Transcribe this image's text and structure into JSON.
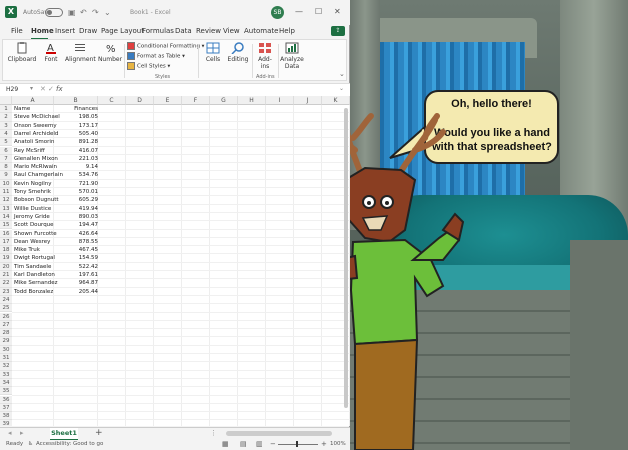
{
  "window": {
    "autosave_label": "AutoSave",
    "autosave_state": "Off",
    "title": "Book1 - Excel",
    "user_initials": "SB"
  },
  "tabs": [
    "File",
    "Home",
    "Insert",
    "Draw",
    "Page Layout",
    "Formulas",
    "Data",
    "Review",
    "View",
    "Automate",
    "Help"
  ],
  "active_tab": "Home",
  "ribbon": {
    "clipboard": "Clipboard",
    "font": "Font",
    "alignment": "Alignment",
    "number": "Number",
    "conditional_formatting": "Conditional Formatting",
    "format_as_table": "Format as Table",
    "cell_styles": "Cell Styles",
    "styles_group": "Styles",
    "cells": "Cells",
    "editing": "Editing",
    "addins": "Add-ins",
    "addins_group": "Add-ins",
    "analyze_data": "Analyze Data"
  },
  "formula_bar": {
    "name_box": "H29",
    "fx": "fx"
  },
  "columns": [
    "A",
    "B",
    "C",
    "D",
    "E",
    "F",
    "G",
    "H",
    "I",
    "J",
    "K"
  ],
  "headers": {
    "a": "Name",
    "b": "Finances"
  },
  "rows": [
    {
      "name": "Steve McDichael",
      "value": "198.05"
    },
    {
      "name": "Onson Sweemy",
      "value": "173.17"
    },
    {
      "name": "Darrel Archideld",
      "value": "505.40"
    },
    {
      "name": "Anatoli Smorin",
      "value": "891.28"
    },
    {
      "name": "Rey McSriff",
      "value": "416.07"
    },
    {
      "name": "Glenallen Mixon",
      "value": "221.03"
    },
    {
      "name": "Mario McRlwain",
      "value": "9.14"
    },
    {
      "name": "Raul Chamgerlain",
      "value": "534.76"
    },
    {
      "name": "Kevin Nogilny",
      "value": "721.90"
    },
    {
      "name": "Tony Smehrik",
      "value": "570.01"
    },
    {
      "name": "Bobson Dugnutt",
      "value": "605.29"
    },
    {
      "name": "Willie Dustice",
      "value": "419.94"
    },
    {
      "name": "Jeromy Gride",
      "value": "890.03"
    },
    {
      "name": "Scott Dourque",
      "value": "194.47"
    },
    {
      "name": "Shown Furcotte",
      "value": "426.64"
    },
    {
      "name": "Dean Wesrey",
      "value": "878.55"
    },
    {
      "name": "Mike Truk",
      "value": "467.45"
    },
    {
      "name": "Dwigt Rortugal",
      "value": "154.59"
    },
    {
      "name": "Tim Sandaele",
      "value": "522.42"
    },
    {
      "name": "Karl Dandleton",
      "value": "197.61"
    },
    {
      "name": "Mike Sernandez",
      "value": "964.87"
    },
    {
      "name": "Todd Bonzalez",
      "value": "205.44"
    }
  ],
  "total_row_numbers": 40,
  "sheet_tab": "Sheet1",
  "status": {
    "ready": "Ready",
    "accessibility": "Accessibility: Good to go",
    "zoom": "100%"
  },
  "speech": {
    "line1": "Oh, hello there!",
    "line2": "Would you like a hand with that spreadsheet?"
  }
}
